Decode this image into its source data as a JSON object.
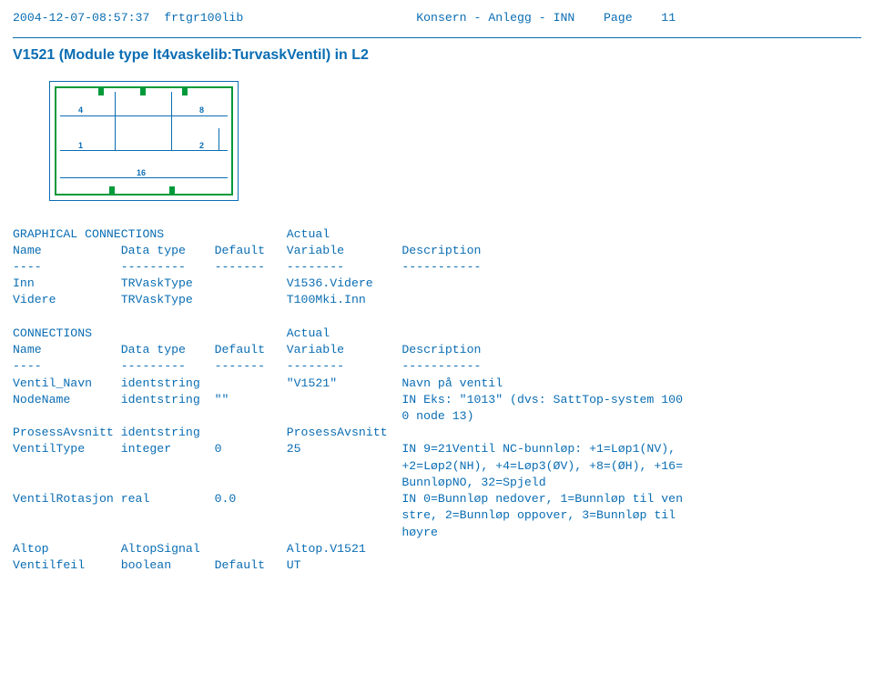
{
  "header": {
    "timestamp": "2004-12-07-08:57:37",
    "lib": "frtgr100lib",
    "center": "Konsern - Anlegg - INN",
    "page_label": "Page",
    "page_num": "11"
  },
  "module_title": "V1521 (Module type lt4vaskelib:TurvaskVentil) in L2",
  "diagram": {
    "labels": {
      "tl": "4",
      "tr": "8",
      "ml": "1",
      "mr": "2",
      "bot": "16"
    }
  },
  "sections": {
    "graphical_heading": "GRAPHICAL CONNECTIONS",
    "actual": "Actual",
    "cols": {
      "name": "Name",
      "dtype": "Data type",
      "def": "Default",
      "var": "Variable",
      "desc": "Description"
    },
    "dash": {
      "name": "----",
      "dtype": "---------",
      "def": "-------",
      "var": "--------",
      "desc": "-----------"
    },
    "graphical_rows": [
      {
        "name": "Inn",
        "dtype": "TRVaskType",
        "def": "",
        "var": "V1536.Videre",
        "desc": ""
      },
      {
        "name": "Videre",
        "dtype": "TRVaskType",
        "def": "",
        "var": "T100Mki.Inn",
        "desc": ""
      }
    ],
    "connections_heading": "CONNECTIONS",
    "conn_rows": [
      {
        "name": "Ventil_Navn",
        "dtype": "identstring",
        "def": "",
        "var": "\"V1521\"",
        "desc": "Navn på ventil"
      },
      {
        "name": "NodeName",
        "dtype": "identstring",
        "def": "\"\"",
        "var": "",
        "desc": "IN Eks: \"1013\" (dvs: SattTop-system 100"
      },
      {
        "name": "",
        "dtype": "",
        "def": "",
        "var": "",
        "desc": "0 node 13)"
      },
      {
        "name": "ProsessAvsnitt",
        "dtype": "identstring",
        "def": "",
        "var": "ProsessAvsnitt",
        "desc": ""
      },
      {
        "name": "VentilType",
        "dtype": "integer",
        "def": "0",
        "var": "25",
        "desc": "IN 9=21Ventil NC-bunnløp: +1=Løp1(NV),"
      },
      {
        "name": "",
        "dtype": "",
        "def": "",
        "var": "",
        "desc": "+2=Løp2(NH), +4=Løp3(ØV), +8=(ØH), +16="
      },
      {
        "name": "",
        "dtype": "",
        "def": "",
        "var": "",
        "desc": "BunnløpNO, 32=Spjeld"
      },
      {
        "name": "VentilRotasjon",
        "dtype": "real",
        "def": "0.0",
        "var": "",
        "desc": "IN 0=Bunnløp nedover, 1=Bunnløp til ven"
      },
      {
        "name": "",
        "dtype": "",
        "def": "",
        "var": "",
        "desc": "stre, 2=Bunnløp oppover, 3=Bunnløp til"
      },
      {
        "name": "",
        "dtype": "",
        "def": "",
        "var": "",
        "desc": "høyre"
      },
      {
        "name": "Altop",
        "dtype": "AltopSignal",
        "def": "",
        "var": "Altop.V1521",
        "desc": ""
      },
      {
        "name": "Ventilfeil",
        "dtype": "boolean",
        "def": "Default",
        "var": "UT",
        "desc": ""
      }
    ]
  }
}
